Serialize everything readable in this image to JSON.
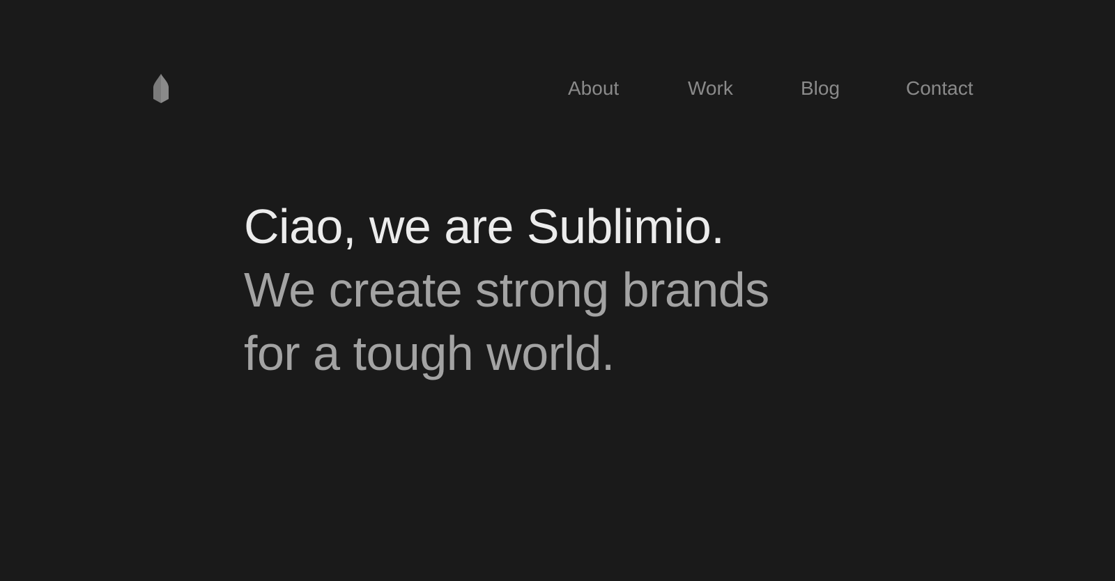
{
  "colors": {
    "background": "#1a1a1a",
    "nav_text": "#8a8a8a",
    "heading_primary": "#ececec",
    "heading_secondary": "#a3a3a3",
    "logo": "#7a7a7a"
  },
  "header": {
    "logo_icon": "sublimio-logo-icon",
    "nav": {
      "about": "About",
      "work": "Work",
      "blog": "Blog",
      "contact": "Contact"
    }
  },
  "hero": {
    "intro": "Ciao, we are Sublimio.",
    "tagline_line1": "We create strong brands",
    "tagline_line2": "for a tough world."
  }
}
